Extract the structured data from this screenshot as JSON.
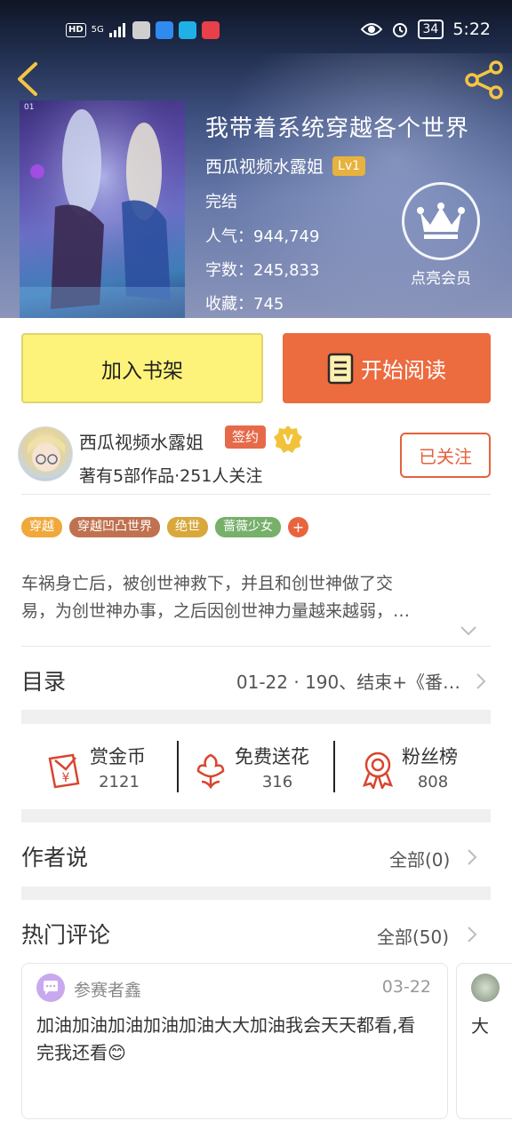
{
  "status_bar": {
    "hd_badge": "HD",
    "network": "5G",
    "time": "5:22",
    "battery": "34",
    "icons": [
      "signal-icon",
      "app-icon-anime",
      "app-icon-cloud",
      "app-icon-search",
      "app-icon-red",
      "eye-icon",
      "alarm-icon",
      "battery-icon"
    ]
  },
  "header": {
    "cover_label": "01",
    "book_title": "我带着系统穿越各个世界",
    "author": "西瓜视频水露姐",
    "author_level": "Lv1",
    "status": "完结",
    "popularity": "人气：944,749",
    "word_count": "字数：245,833",
    "favorites": "收藏：745",
    "vip_label": "点亮会员"
  },
  "actions": {
    "add_to_shelf": "加入书架",
    "start_reading": "开始阅读"
  },
  "author_info": {
    "name": "西瓜视频水露姐",
    "sign_badge": "签约",
    "v_badge": "V",
    "stats": "著有5部作品·251人关注",
    "follow_label": "已关注"
  },
  "tags": [
    {
      "label": "穿越",
      "color": "#f0a83a"
    },
    {
      "label": "穿越凹凸世界",
      "color": "#c0714f"
    },
    {
      "label": "绝世",
      "color": "#d9a83c"
    },
    {
      "label": "蔷薇少女",
      "color": "#76b06a"
    }
  ],
  "tag_more": "+",
  "synopsis": {
    "line1": "车祸身亡后，被创世神救下，并且和创世神做了交",
    "line2": "易，为创世神办事，之后因创世神力量越来越弱，…"
  },
  "toc": {
    "title": "目录",
    "latest": "01-22 · 190、结束+《番…"
  },
  "stats": [
    {
      "label": "赏金币",
      "value": "2121",
      "icon": "red-envelope-icon"
    },
    {
      "label": "免费送花",
      "value": "316",
      "icon": "flower-icon"
    },
    {
      "label": "粉丝榜",
      "value": "808",
      "icon": "medal-icon"
    }
  ],
  "author_says": {
    "title": "作者说",
    "more": "全部(0)"
  },
  "hot_comments": {
    "title": "热门评论",
    "more": "全部(50)",
    "items": [
      {
        "user": "参赛者鑫",
        "date": "03-22",
        "text": "加油加油加油加油加油大大加油我会天天都看,看完我还看😊"
      },
      {
        "text": "大"
      }
    ]
  },
  "colors": {
    "accent_orange": "#ec6b3f",
    "shelf_yellow": "#fef37a",
    "level_gold": "#e7b23d"
  }
}
